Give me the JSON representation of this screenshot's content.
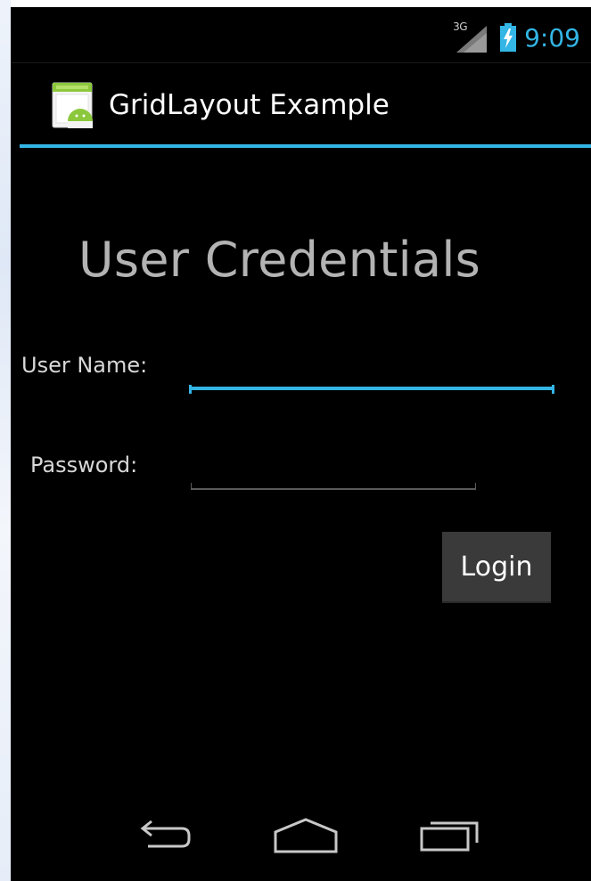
{
  "status_bar": {
    "network_type": "3G",
    "time": "9:09",
    "icons": [
      "signal-icon",
      "battery-charging-icon"
    ]
  },
  "action_bar": {
    "app_icon": "android-app-icon",
    "title": "GridLayout Example"
  },
  "form": {
    "heading": "User Credentials",
    "username_label": "User Name:",
    "username_value": "",
    "password_label": "Password:",
    "password_value": "",
    "login_label": "Login"
  },
  "nav_bar": {
    "icons": [
      "back-icon",
      "home-icon",
      "recents-icon"
    ]
  },
  "colors": {
    "accent": "#33b5e5",
    "background": "#000000",
    "heading_text": "#b3b3b3",
    "button_bg": "#3a3a3a"
  }
}
